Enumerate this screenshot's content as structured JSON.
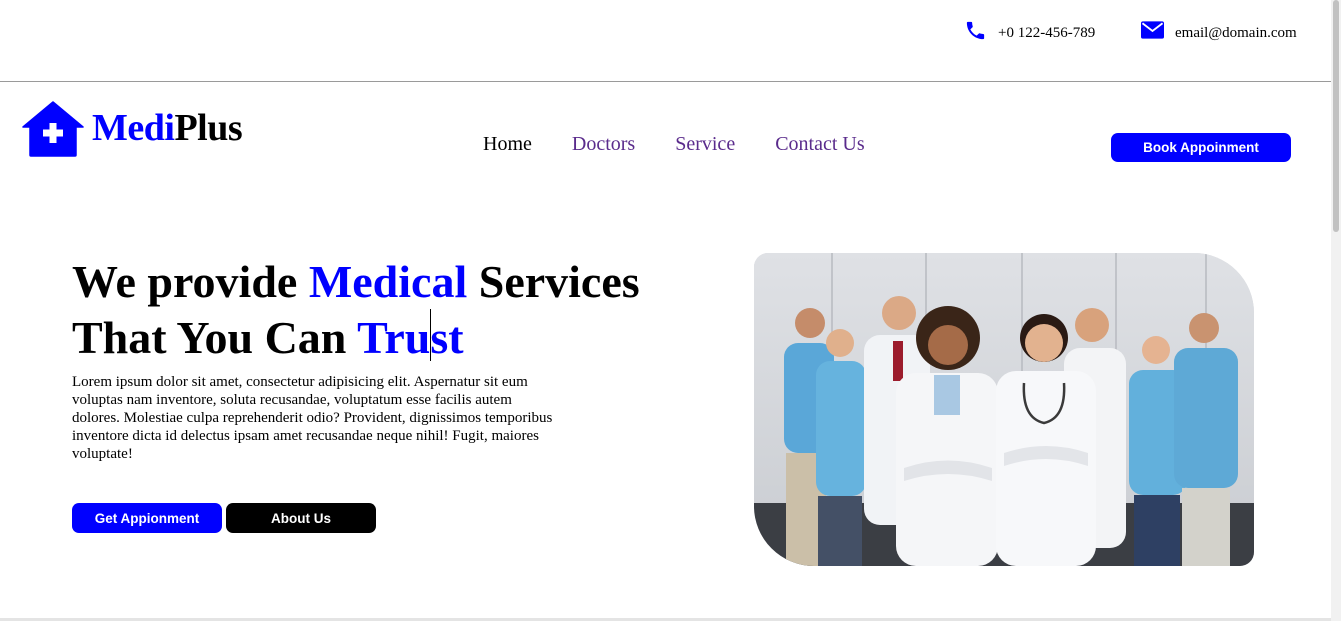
{
  "contact": {
    "phone": "+0 122-456-789",
    "email": "email@domain.com"
  },
  "brand": {
    "part1": "Medi",
    "part2": "Plus"
  },
  "nav": {
    "items": [
      "Home",
      "Doctors",
      "Service",
      "Contact Us"
    ]
  },
  "header": {
    "book_label": "Book Appoinment"
  },
  "hero": {
    "title_line1_a": "We provide ",
    "title_line1_b": "Medical",
    "title_line1_c": " Services",
    "title_line2_a": "That You Can ",
    "title_line2_b": "Tru",
    "title_line2_c": "st",
    "body": "Lorem ipsum dolor sit amet, consectetur adipisicing elit. Aspernatur sit eum voluptas nam inventore, soluta recusandae, voluptatum esse facilis autem dolores. Molestiae culpa reprehenderit odio? Provident, dignissimos temporibus inventore dicta id delectus ipsam amet recusandae neque nihil! Fugit, maiores voluptate!",
    "primary_button": "Get Appionment",
    "secondary_button": "About Us"
  },
  "icons": {
    "phone": "phone-icon",
    "email": "envelope-icon",
    "logo": "house-medical-icon"
  },
  "colors": {
    "accent": "#0000ff",
    "nav_link": "#5a2b8c",
    "dark_button": "#000000"
  }
}
